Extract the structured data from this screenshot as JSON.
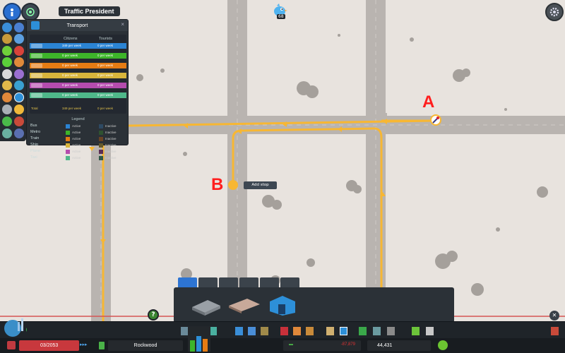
{
  "app": {
    "title": "Traffic President"
  },
  "chirper": {
    "count": "68"
  },
  "panel": {
    "title": "Transport",
    "close": "×",
    "col_citizens": "Citizens",
    "col_tourists": "Tourists",
    "rows": [
      {
        "mode": "bus",
        "color": "#2b84d4",
        "citizens": "349 per week",
        "tourists": "0 per week"
      },
      {
        "mode": "metro",
        "color": "#3db52a",
        "citizens": "0 per week",
        "tourists": "0 per week"
      },
      {
        "mode": "train",
        "color": "#e57c14",
        "citizens": "0 per week",
        "tourists": "0 per week"
      },
      {
        "mode": "ship",
        "color": "#d8b53c",
        "citizens": "0 per week",
        "tourists": "0 per week"
      },
      {
        "mode": "plane",
        "color": "#b54cae",
        "citizens": "0 per week",
        "tourists": "0 per week"
      },
      {
        "mode": "taxi",
        "color": "#4fb88a",
        "citizens": "0 per week",
        "tourists": "0 per week"
      }
    ],
    "total_label": "Total",
    "total_citizens": "349 per week",
    "total_tourists": "0 per week",
    "legend_title": "Legend",
    "legend": [
      {
        "name": "Bus",
        "active": "Active",
        "inactive": "Inactive",
        "active_color": "#2b84d4",
        "inactive_color": "#2e4a63"
      },
      {
        "name": "Metro",
        "active": "Active",
        "inactive": "Inactive",
        "active_color": "#3db52a",
        "inactive_color": "#2f5230"
      },
      {
        "name": "Train",
        "active": "Active",
        "inactive": "Inactive",
        "active_color": "#e57c14",
        "inactive_color": "#6a4324"
      },
      {
        "name": "Ship",
        "active": "Active",
        "inactive": "Inactive",
        "active_color": "#d8b53c",
        "inactive_color": "#655a2c"
      },
      {
        "name": "Plane",
        "active": "Active",
        "inactive": "Inactive",
        "active_color": "#b54cae",
        "inactive_color": "#5a2d55"
      },
      {
        "name": "Taxi",
        "active": "Active",
        "inactive": "Inactive",
        "active_color": "#4fb88a",
        "inactive_color": "#2e5848"
      }
    ]
  },
  "route": {
    "label_a": "A",
    "label_b": "B",
    "add_stop": "Add stop",
    "route_color": "#f7b733"
  },
  "status_bar": {
    "date": "03/2053",
    "speed": "▸▸▸",
    "city_name": "Rockwood",
    "income": "▬",
    "money": "-87,879",
    "population": "44,431"
  },
  "icons": {
    "info": "info-icon",
    "unlock": "milestone-icon",
    "settings": "gear-icon",
    "chirper": "chirper-bird-icon",
    "question": "?"
  }
}
